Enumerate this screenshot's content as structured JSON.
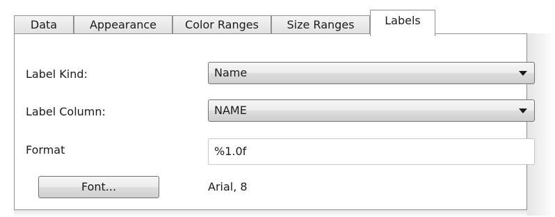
{
  "tabs": [
    {
      "label": "Data"
    },
    {
      "label": "Appearance"
    },
    {
      "label": "Color Ranges"
    },
    {
      "label": "Size Ranges"
    },
    {
      "label": "Labels"
    }
  ],
  "active_tab": "Labels",
  "form": {
    "label_kind": {
      "label": "Label Kind:",
      "value": "Name"
    },
    "label_column": {
      "label": "Label Column:",
      "value": "NAME"
    },
    "format": {
      "label": "Format",
      "value": "%1.0f"
    },
    "font": {
      "button_label": "Font...",
      "value": "Arial, 8"
    }
  },
  "icons": {
    "dropdown_arrow": "chevron-down-icon"
  }
}
